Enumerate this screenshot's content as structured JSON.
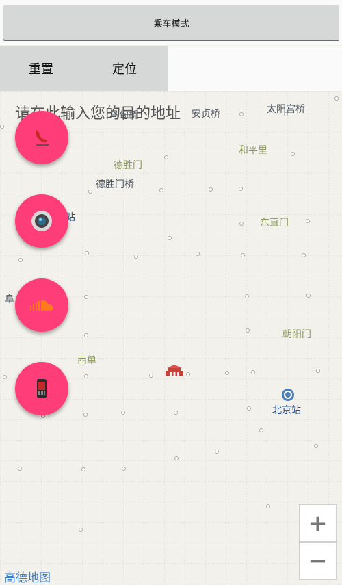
{
  "header": {
    "mode_label": "乘车模式"
  },
  "actions": {
    "reset_label": "重置",
    "locate_label": "定位"
  },
  "search": {
    "placeholder": "请在此输入您的目的地址"
  },
  "map": {
    "places": [
      {
        "id": "taiyanggong",
        "name": "太阳宫桥",
        "style": "dark"
      },
      {
        "id": "anzhen",
        "name": "安贞桥",
        "style": "dark"
      },
      {
        "id": "madian",
        "name": "马甸桥",
        "style": "dark"
      },
      {
        "id": "hepingli",
        "name": "和平里",
        "style": "green"
      },
      {
        "id": "deshengmen",
        "name": "德胜门",
        "style": "green"
      },
      {
        "id": "deshengmenqiao",
        "name": "德胜门桥",
        "style": "dark"
      },
      {
        "id": "dongzhimen",
        "name": "东直门",
        "style": "green"
      },
      {
        "id": "station_frag",
        "name": "站",
        "style": "blue"
      },
      {
        "id": "fu_frag",
        "name": "阜",
        "style": "dark"
      },
      {
        "id": "chaoyangmen",
        "name": "朝阳门",
        "style": "green"
      },
      {
        "id": "xidan",
        "name": "西单",
        "style": "green"
      },
      {
        "id": "beijingzhan",
        "name": "北京站",
        "style": "blue"
      }
    ],
    "logo": "高德地图",
    "zoom_in": "+",
    "zoom_out": "−"
  },
  "fabs": [
    {
      "id": "phone",
      "icon": "phone-icon"
    },
    {
      "id": "camera",
      "icon": "camera-icon"
    },
    {
      "id": "cloud",
      "icon": "soundcloud-icon"
    },
    {
      "id": "mobile",
      "icon": "mobile-phone-icon"
    }
  ],
  "colors": {
    "fab": "#ff3d78",
    "map_bg": "#f2f1ec",
    "button_gray": "#d6d7d7",
    "logo_blue": "#3a7bc8"
  }
}
